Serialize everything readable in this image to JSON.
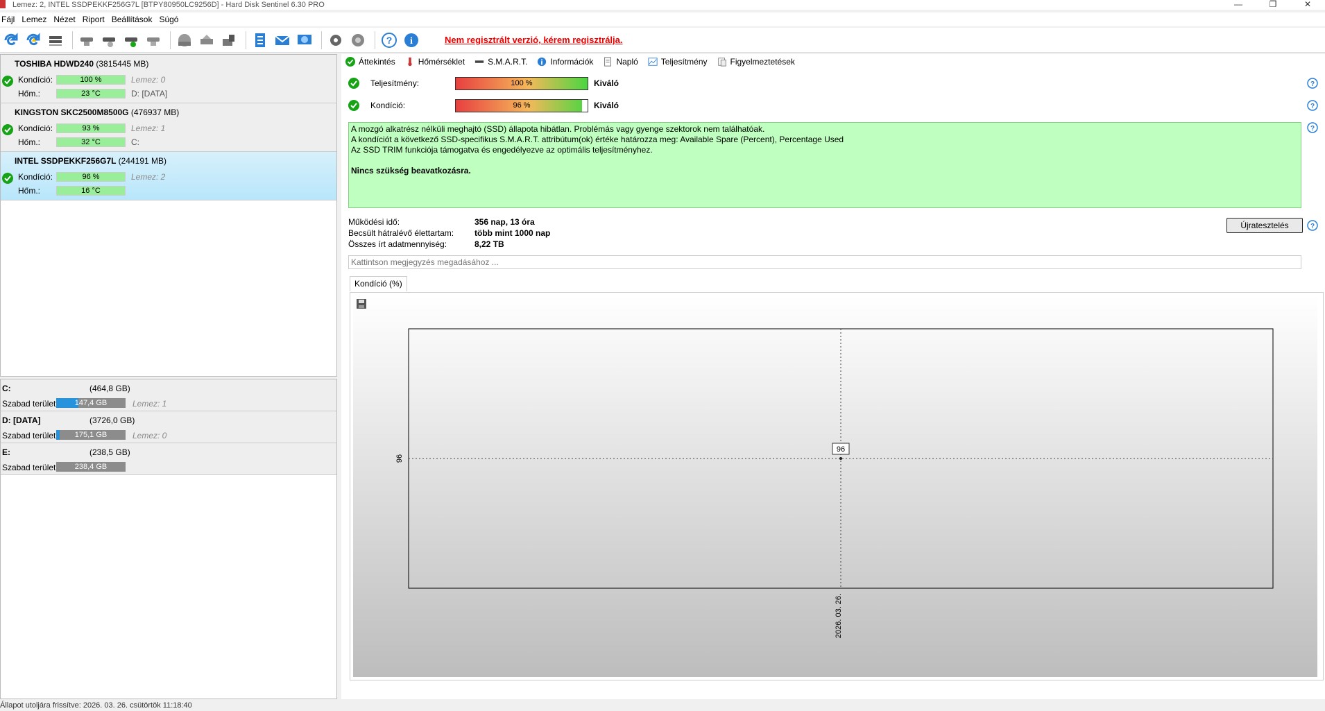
{
  "window": {
    "title": "Lemez: 2, INTEL SSDPEKKF256G7L [BTPY80950LC9256D]  -  Hard Disk Sentinel 6.30 PRO",
    "buttons": [
      "—",
      "❐",
      "✕"
    ]
  },
  "menu": [
    "Fájl",
    "Lemez",
    "Nézet",
    "Riport",
    "Beállítások",
    "Súgó"
  ],
  "toolbar": {
    "registration_text": "Nem regisztrált verzió, kérem regisztrálja."
  },
  "disks": [
    {
      "name": "TOSHIBA HDWD240",
      "size": "(3815445 MB)",
      "condition_label": "Kondíció:",
      "condition_value": "100 %",
      "condition_note": "Lemez: 0",
      "temp_label": "Hőm.:",
      "temp_value": "23 °C",
      "temp_note": "D: [DATA]"
    },
    {
      "name": "KINGSTON SKC2500M8500G",
      "size": "(476937 MB)",
      "condition_label": "Kondíció:",
      "condition_value": "93 %",
      "condition_note": "Lemez: 1",
      "temp_label": "Hőm.:",
      "temp_value": "32 °C",
      "temp_note": "C:"
    },
    {
      "name": "INTEL SSDPEKKF256G7L",
      "size": "(244191 MB)",
      "condition_label": "Kondíció:",
      "condition_value": "96 %",
      "condition_note": "Lemez: 2",
      "temp_label": "Hőm.:",
      "temp_value": "16 °C",
      "temp_note": ""
    }
  ],
  "volumes": [
    {
      "name": "C:",
      "size": "(464,8 GB)",
      "label": "Szabad terület",
      "free": "147,4 GB",
      "free_fraction": 0.32,
      "note": "Lemez: 1"
    },
    {
      "name": "D: [DATA]",
      "size": "(3726,0 GB)",
      "label": "Szabad terület",
      "free": "175,1 GB",
      "free_fraction": 0.05,
      "note": "Lemez: 0"
    },
    {
      "name": "E:",
      "size": "(238,5 GB)",
      "label": "Szabad terület",
      "free": "238,4 GB",
      "free_fraction": 1.0,
      "note": ""
    }
  ],
  "tabs": [
    "Áttekintés",
    "Hőmérséklet",
    "S.M.A.R.T.",
    "Információk",
    "Napló",
    "Teljesítmény",
    "Figyelmeztetések"
  ],
  "performance": {
    "label": "Teljesítmény:",
    "value": "100 %",
    "fraction": 1.0,
    "rating": "Kiváló"
  },
  "condition": {
    "label": "Kondíció:",
    "value": "96 %",
    "fraction": 0.96,
    "rating": "Kiváló"
  },
  "status_text": {
    "line1": "A mozgó alkatrész nélküli meghajtó (SSD) állapota hibátlan. Problémás vagy gyenge szektorok nem találhatóak.",
    "line2": "A kondíciót a következő SSD-specifikus S.M.A.R.T. attribútum(ok) értéke határozza meg:  Available Spare (Percent), Percentage Used",
    "line3": "Az SSD TRIM funkciója támogatva és engedélyezve az optimális teljesítményhez.",
    "line4": "Nincs szükség beavatkozásra."
  },
  "stats": [
    {
      "key": "Működési idő:",
      "value": "356 nap, 13 óra"
    },
    {
      "key": "Becsült hátralévő élettartam:",
      "value": "több mint 1000 nap"
    },
    {
      "key": "Összes írt adatmennyiség:",
      "value": "8,22 TB"
    }
  ],
  "retest_button": "Újratesztelés",
  "note_placeholder": "Kattintson megjegyzés megadásához ...",
  "chart_tab": "Kondíció  (%)",
  "chart_data": {
    "type": "line",
    "x": [
      "2026. 03. 26."
    ],
    "series": [
      {
        "values": [
          96
        ]
      }
    ],
    "ytick": "96",
    "xtick": "2026. 03. 26.",
    "data_label": "96"
  },
  "statusbar": "Állapot utoljára frissítve: 2026. 03. 26. csütörtök 11:18:40"
}
